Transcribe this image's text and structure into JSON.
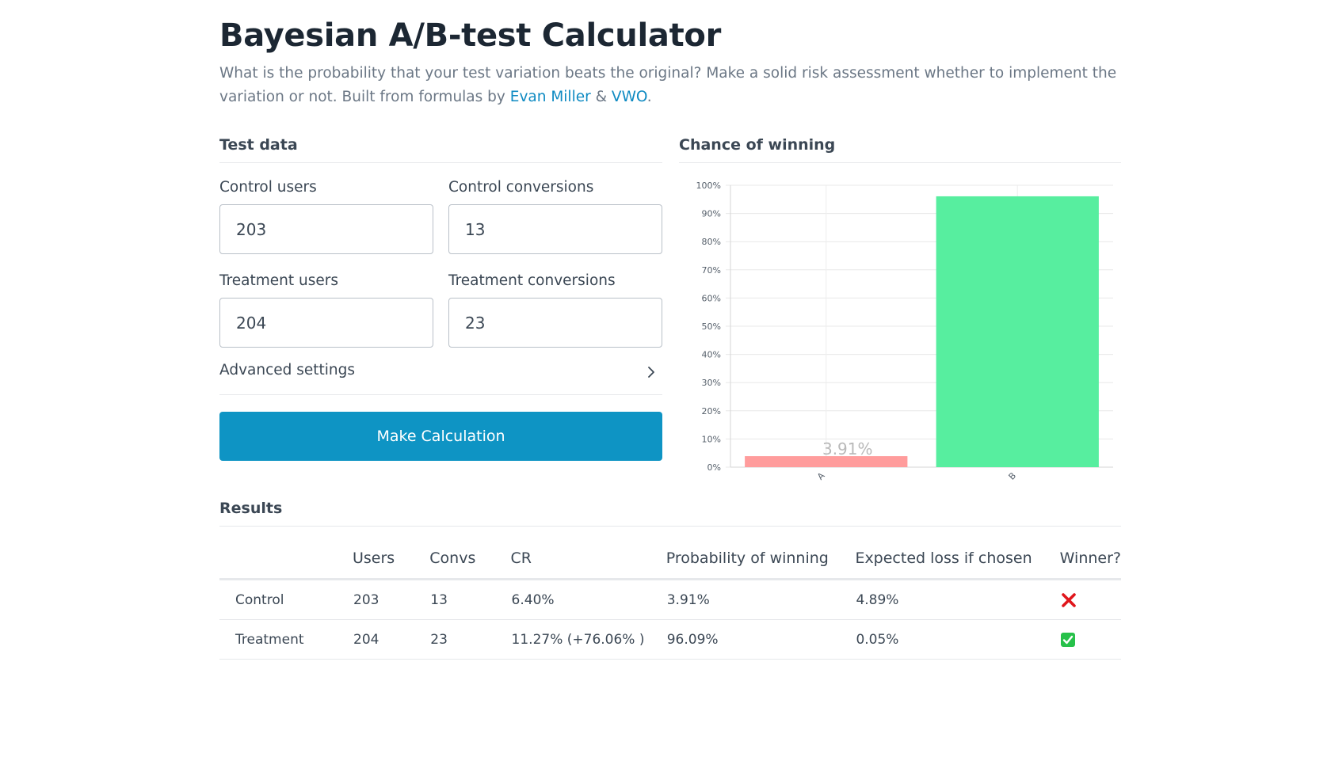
{
  "header": {
    "title": "Bayesian A/B-test Calculator",
    "intro_text": "What is the probability that your test variation beats the original? Make a solid risk assessment whether to implement the variation or not. Built from formulas by",
    "link_evan": "Evan Miller",
    "amp": "&",
    "link_vwo": "VWO",
    "period": "."
  },
  "test_data": {
    "title": "Test data",
    "control_users_label": "Control users",
    "control_users_value": "203",
    "control_conversions_label": "Control conversions",
    "control_conversions_value": "13",
    "treatment_users_label": "Treatment users",
    "treatment_users_value": "204",
    "treatment_conversions_label": "Treatment conversions",
    "treatment_conversions_value": "23",
    "advanced_label": "Advanced settings",
    "calculate_label": "Make Calculation"
  },
  "chart_section": {
    "title": "Chance of winning"
  },
  "chart_data": {
    "type": "bar",
    "categories": [
      "A",
      "B"
    ],
    "values": [
      3.91,
      96.09
    ],
    "bar_colors": [
      "#ff9c9c",
      "#57ee9f"
    ],
    "ylim": [
      0,
      100
    ],
    "yticks": [
      "0%",
      "10%",
      "20%",
      "30%",
      "40%",
      "50%",
      "60%",
      "70%",
      "80%",
      "90%",
      "100%"
    ],
    "data_labels": [
      "3.91%",
      ""
    ],
    "grid": true
  },
  "results": {
    "title": "Results",
    "headers": [
      "",
      "Users",
      "Convs",
      "CR",
      "Probability of winning",
      "Expected loss if chosen",
      "Winner?"
    ],
    "rows": [
      {
        "name": "Control",
        "users": "203",
        "convs": "13",
        "cr": "6.40%",
        "prob": "3.91%",
        "loss": "4.89%",
        "winner": "cross-mark-icon"
      },
      {
        "name": "Treatment",
        "users": "204",
        "convs": "23",
        "cr": "11.27% (+76.06% )",
        "prob": "96.09%",
        "loss": "0.05%",
        "winner": "check-mark-icon"
      }
    ],
    "cross_color": "#e0161b",
    "check_color": "#27c14a"
  }
}
